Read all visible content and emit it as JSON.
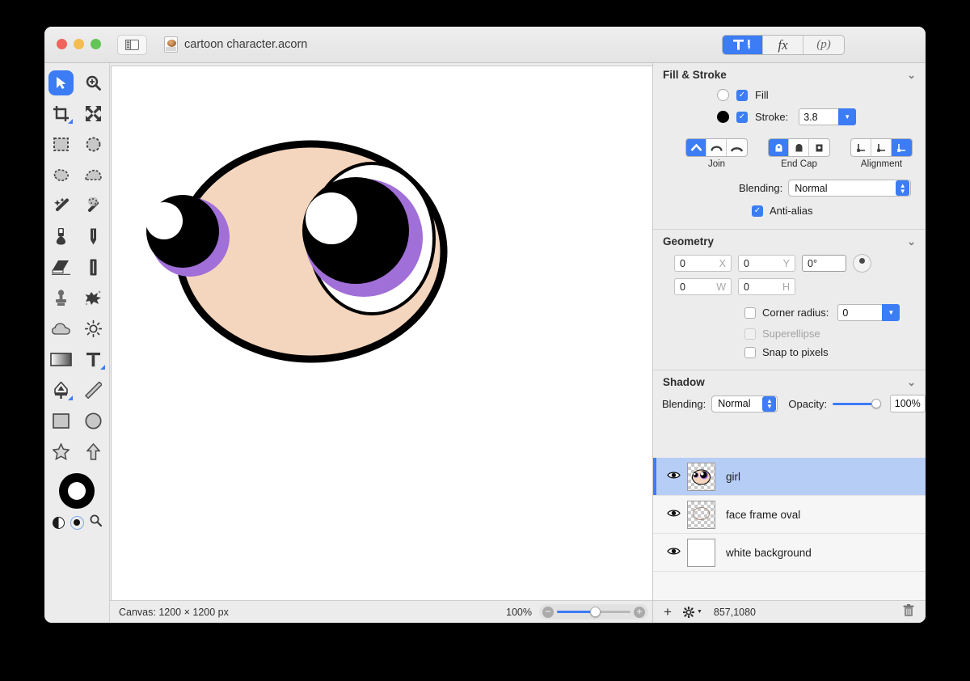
{
  "titlebar": {
    "document_name": "cartoon character.acorn",
    "sidebar_toggle_icon": "sidebar-icon",
    "segments": [
      {
        "label": "",
        "icon": "tool-pen-icon",
        "selected": true
      },
      {
        "label": "fx",
        "icon": "fx-icon",
        "selected": false
      },
      {
        "label": "(p)",
        "icon": "presets-icon",
        "selected": false
      }
    ]
  },
  "tools": {
    "items": [
      {
        "name": "move-select-tool",
        "active": true
      },
      {
        "name": "zoom-tool",
        "active": false
      },
      {
        "name": "crop-tool",
        "active": false
      },
      {
        "name": "transform-tool",
        "active": false
      },
      {
        "name": "rect-select-tool",
        "active": false
      },
      {
        "name": "ellipse-select-tool",
        "active": false
      },
      {
        "name": "lasso-select-tool",
        "active": false
      },
      {
        "name": "polygon-select-tool",
        "active": false
      },
      {
        "name": "magic-wand-tool",
        "active": false
      },
      {
        "name": "magic-wand-soft-tool",
        "active": false
      },
      {
        "name": "paint-bucket-tool",
        "active": false
      },
      {
        "name": "pencil-tool",
        "active": false
      },
      {
        "name": "eraser-tool",
        "active": false
      },
      {
        "name": "smudge-tool",
        "active": false
      },
      {
        "name": "clone-stamp-tool",
        "active": false
      },
      {
        "name": "smudge-splatter-tool",
        "active": false
      },
      {
        "name": "blur-tool",
        "active": false
      },
      {
        "name": "dodge-burn-tool",
        "active": false
      },
      {
        "name": "gradient-tool",
        "active": false
      },
      {
        "name": "text-tool",
        "active": false
      },
      {
        "name": "bezier-pen-tool",
        "active": false
      },
      {
        "name": "line-tool",
        "active": false
      },
      {
        "name": "rectangle-shape-tool",
        "active": false
      },
      {
        "name": "ellipse-shape-tool",
        "active": false
      },
      {
        "name": "star-shape-tool",
        "active": false
      },
      {
        "name": "arrow-shape-tool",
        "active": false
      }
    ],
    "color_well": {
      "stroke_color": "#000000",
      "fill_color": "#ffffff"
    }
  },
  "fill_stroke": {
    "title": "Fill & Stroke",
    "fill_label": "Fill",
    "fill_checked": true,
    "fill_color": "#ffffff",
    "stroke_label": "Stroke:",
    "stroke_checked": true,
    "stroke_color": "#000000",
    "stroke_width": "3.8",
    "join_label": "Join",
    "join_selected_index": 0,
    "endcap_label": "End Cap",
    "endcap_selected_index": 0,
    "alignment_label": "Alignment",
    "alignment_selected_index": 2,
    "blending_label": "Blending:",
    "blending_value": "Normal",
    "antialias_label": "Anti-alias",
    "antialias_checked": true
  },
  "geometry": {
    "title": "Geometry",
    "x_value": "0",
    "x_label": "X",
    "y_value": "0",
    "y_label": "Y",
    "rotation_value": "0°",
    "w_value": "0",
    "w_label": "W",
    "h_value": "0",
    "h_label": "H",
    "corner_radius_label": "Corner radius:",
    "corner_radius_checked": false,
    "corner_radius_value": "0",
    "superellipse_label": "Superellipse",
    "superellipse_checked": false,
    "superellipse_disabled": true,
    "snap_label": "Snap to pixels",
    "snap_checked": false
  },
  "shadow": {
    "title": "Shadow",
    "blending_label": "Blending:",
    "blending_value": "Normal",
    "opacity_label": "Opacity:",
    "opacity_value": "100%"
  },
  "layers": {
    "items": [
      {
        "name": "girl",
        "visible": true,
        "selected": true,
        "thumb": "character-thumb"
      },
      {
        "name": "face frame oval",
        "visible": true,
        "selected": false,
        "thumb": "oval-thumb"
      },
      {
        "name": "white background",
        "visible": true,
        "selected": false,
        "thumb": "white-thumb"
      }
    ],
    "add_button": "+",
    "settings_button": "gear-icon",
    "coordinates": "857,1080",
    "delete_button": "trash-icon"
  },
  "statusbar": {
    "canvas_label": "Canvas: 1200 × 1200 px",
    "zoom_percent": "100%"
  },
  "artwork": {
    "description": "cartoon girl face with two large eyes",
    "skin_color": "#f4d5bd",
    "outline_color": "#000000",
    "iris_purple": "#a06fd8",
    "pupil_color": "#000000",
    "highlight_color": "#ffffff"
  },
  "colors": {
    "accent": "#3c7cf4",
    "window_bg": "#ececec",
    "selection": "#b6cdf5"
  }
}
